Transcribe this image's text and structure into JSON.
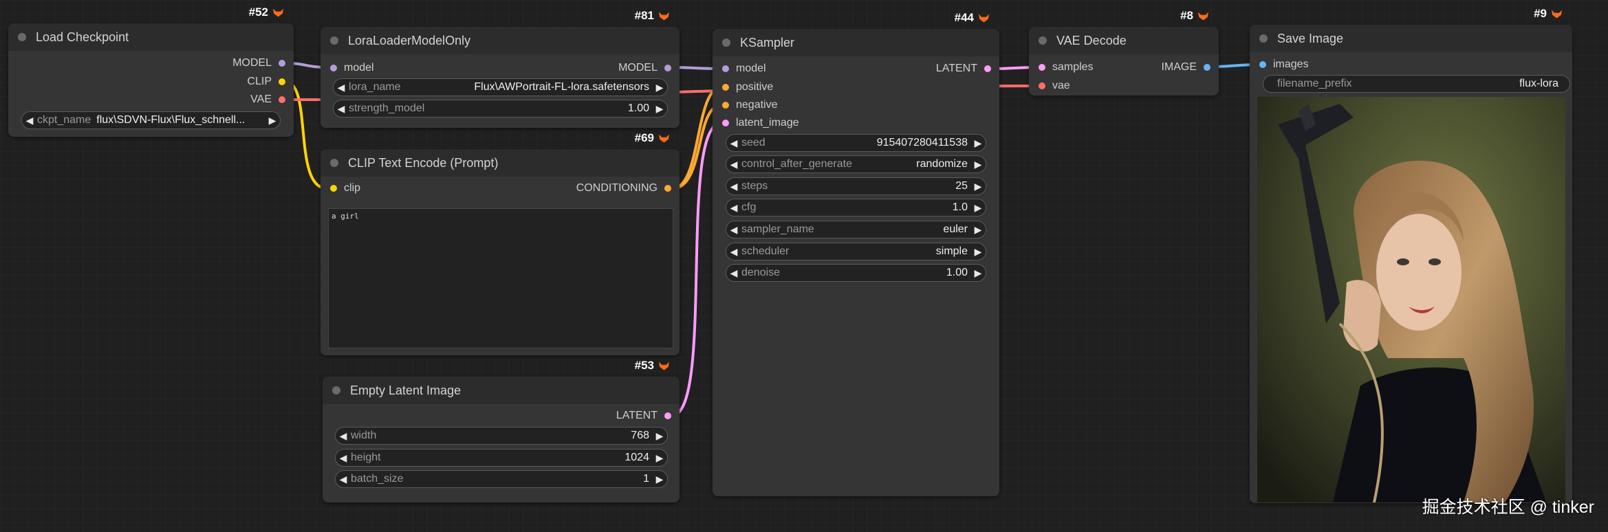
{
  "colors": {
    "canvas": "#202020",
    "node_body": "#353535",
    "node_header": "#2c2c2c",
    "model_slot": "#b39ddb",
    "clip_slot": "#ffd500",
    "vae_slot": "#ff6e6e",
    "conditioning_slot": "#ffa931",
    "latent_slot": "#ff9cf9",
    "image_slot": "#64b5f6",
    "badge_icon": "#ff6a1a"
  },
  "nodes": {
    "load_checkpoint": {
      "title": "Load Checkpoint",
      "badge": "#52",
      "outputs": [
        "MODEL",
        "CLIP",
        "VAE"
      ],
      "widgets": [
        {
          "label": "ckpt_name",
          "value": "flux\\SDVN-Flux\\Flux_schnell..."
        }
      ]
    },
    "lora_loader": {
      "title": "LoraLoaderModelOnly",
      "badge": "#81",
      "input": "model",
      "output": "MODEL",
      "widgets": [
        {
          "label": "lora_name",
          "value": "Flux\\AWPortrait-FL-lora.safetensors"
        },
        {
          "label": "strength_model",
          "value": "1.00"
        }
      ]
    },
    "clip_text_encode": {
      "title": "CLIP Text Encode (Prompt)",
      "badge": "#69",
      "input": "clip",
      "output": "CONDITIONING",
      "text": "a girl"
    },
    "empty_latent": {
      "title": "Empty Latent Image",
      "badge": "#53",
      "output": "LATENT",
      "widgets": [
        {
          "label": "width",
          "value": "768"
        },
        {
          "label": "height",
          "value": "1024"
        },
        {
          "label": "batch_size",
          "value": "1"
        }
      ]
    },
    "ksampler": {
      "title": "KSampler",
      "badge": "#44",
      "inputs": [
        "model",
        "positive",
        "negative",
        "latent_image"
      ],
      "output": "LATENT",
      "widgets": [
        {
          "label": "seed",
          "value": "915407280411538"
        },
        {
          "label": "control_after_generate",
          "value": "randomize"
        },
        {
          "label": "steps",
          "value": "25"
        },
        {
          "label": "cfg",
          "value": "1.0"
        },
        {
          "label": "sampler_name",
          "value": "euler"
        },
        {
          "label": "scheduler",
          "value": "simple"
        },
        {
          "label": "denoise",
          "value": "1.00"
        }
      ]
    },
    "vae_decode": {
      "title": "VAE Decode",
      "badge": "#8",
      "inputs": [
        "samples",
        "vae"
      ],
      "output": "IMAGE"
    },
    "save_image": {
      "title": "Save Image",
      "badge": "#9",
      "input": "images",
      "widgets": [
        {
          "label": "filename_prefix",
          "value": "flux-lora"
        }
      ]
    }
  },
  "watermark": "掘金技术社区 @ tinker"
}
